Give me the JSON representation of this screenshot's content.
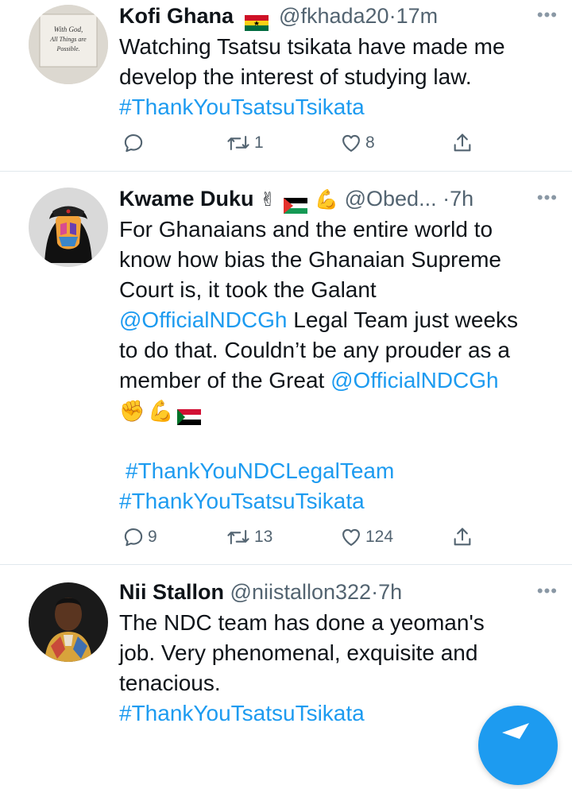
{
  "tweets": [
    {
      "name": "Kofi Ghana",
      "handle": "@fkhada20",
      "time": "17m",
      "lines": [
        "Watching Tsatsu tsikata have made me",
        "develop the interest of studying law."
      ],
      "hashtags": [
        "#ThankYouTsatsuTsikata"
      ],
      "avatar_text": [
        "With God,",
        "All Things are",
        "Possible."
      ],
      "replies": "",
      "retweets": "1",
      "likes": "8"
    },
    {
      "name": "Kwame Duku",
      "handle": "@Obed...",
      "time": "7h",
      "lines": [
        "For Ghanaians and the entire world to",
        "know how bias the Ghanaian Supreme",
        "Court is, it took the Galant",
        "Legal Team just weeks",
        "to do that. Couldn’t be any prouder as a",
        "member of the Great"
      ],
      "mention": "@OfficialNDCGh",
      "hashtags": [
        "#ThankYouNDCLegalTeam",
        "#ThankYouTsatsuTsikata"
      ],
      "replies": "9",
      "retweets": "13",
      "likes": "124"
    },
    {
      "name": "Nii Stallon",
      "handle": "@niistallon322",
      "time": "7h",
      "lines": [
        "The NDC team has done a yeoman's",
        "job. Very phenomenal, exquisite and",
        "tenacious."
      ],
      "hashtags": [
        "#ThankYouTsatsuTsikata"
      ]
    }
  ],
  "separator": "·",
  "more_glyph": "•••",
  "icons": {
    "reply": "reply-icon",
    "retweet": "retweet-icon",
    "like": "heart-icon",
    "share": "share-icon",
    "compose": "compose-icon"
  },
  "colors": {
    "link": "#1d9bf0",
    "muted": "#536471",
    "divider": "#e1e8ed"
  }
}
